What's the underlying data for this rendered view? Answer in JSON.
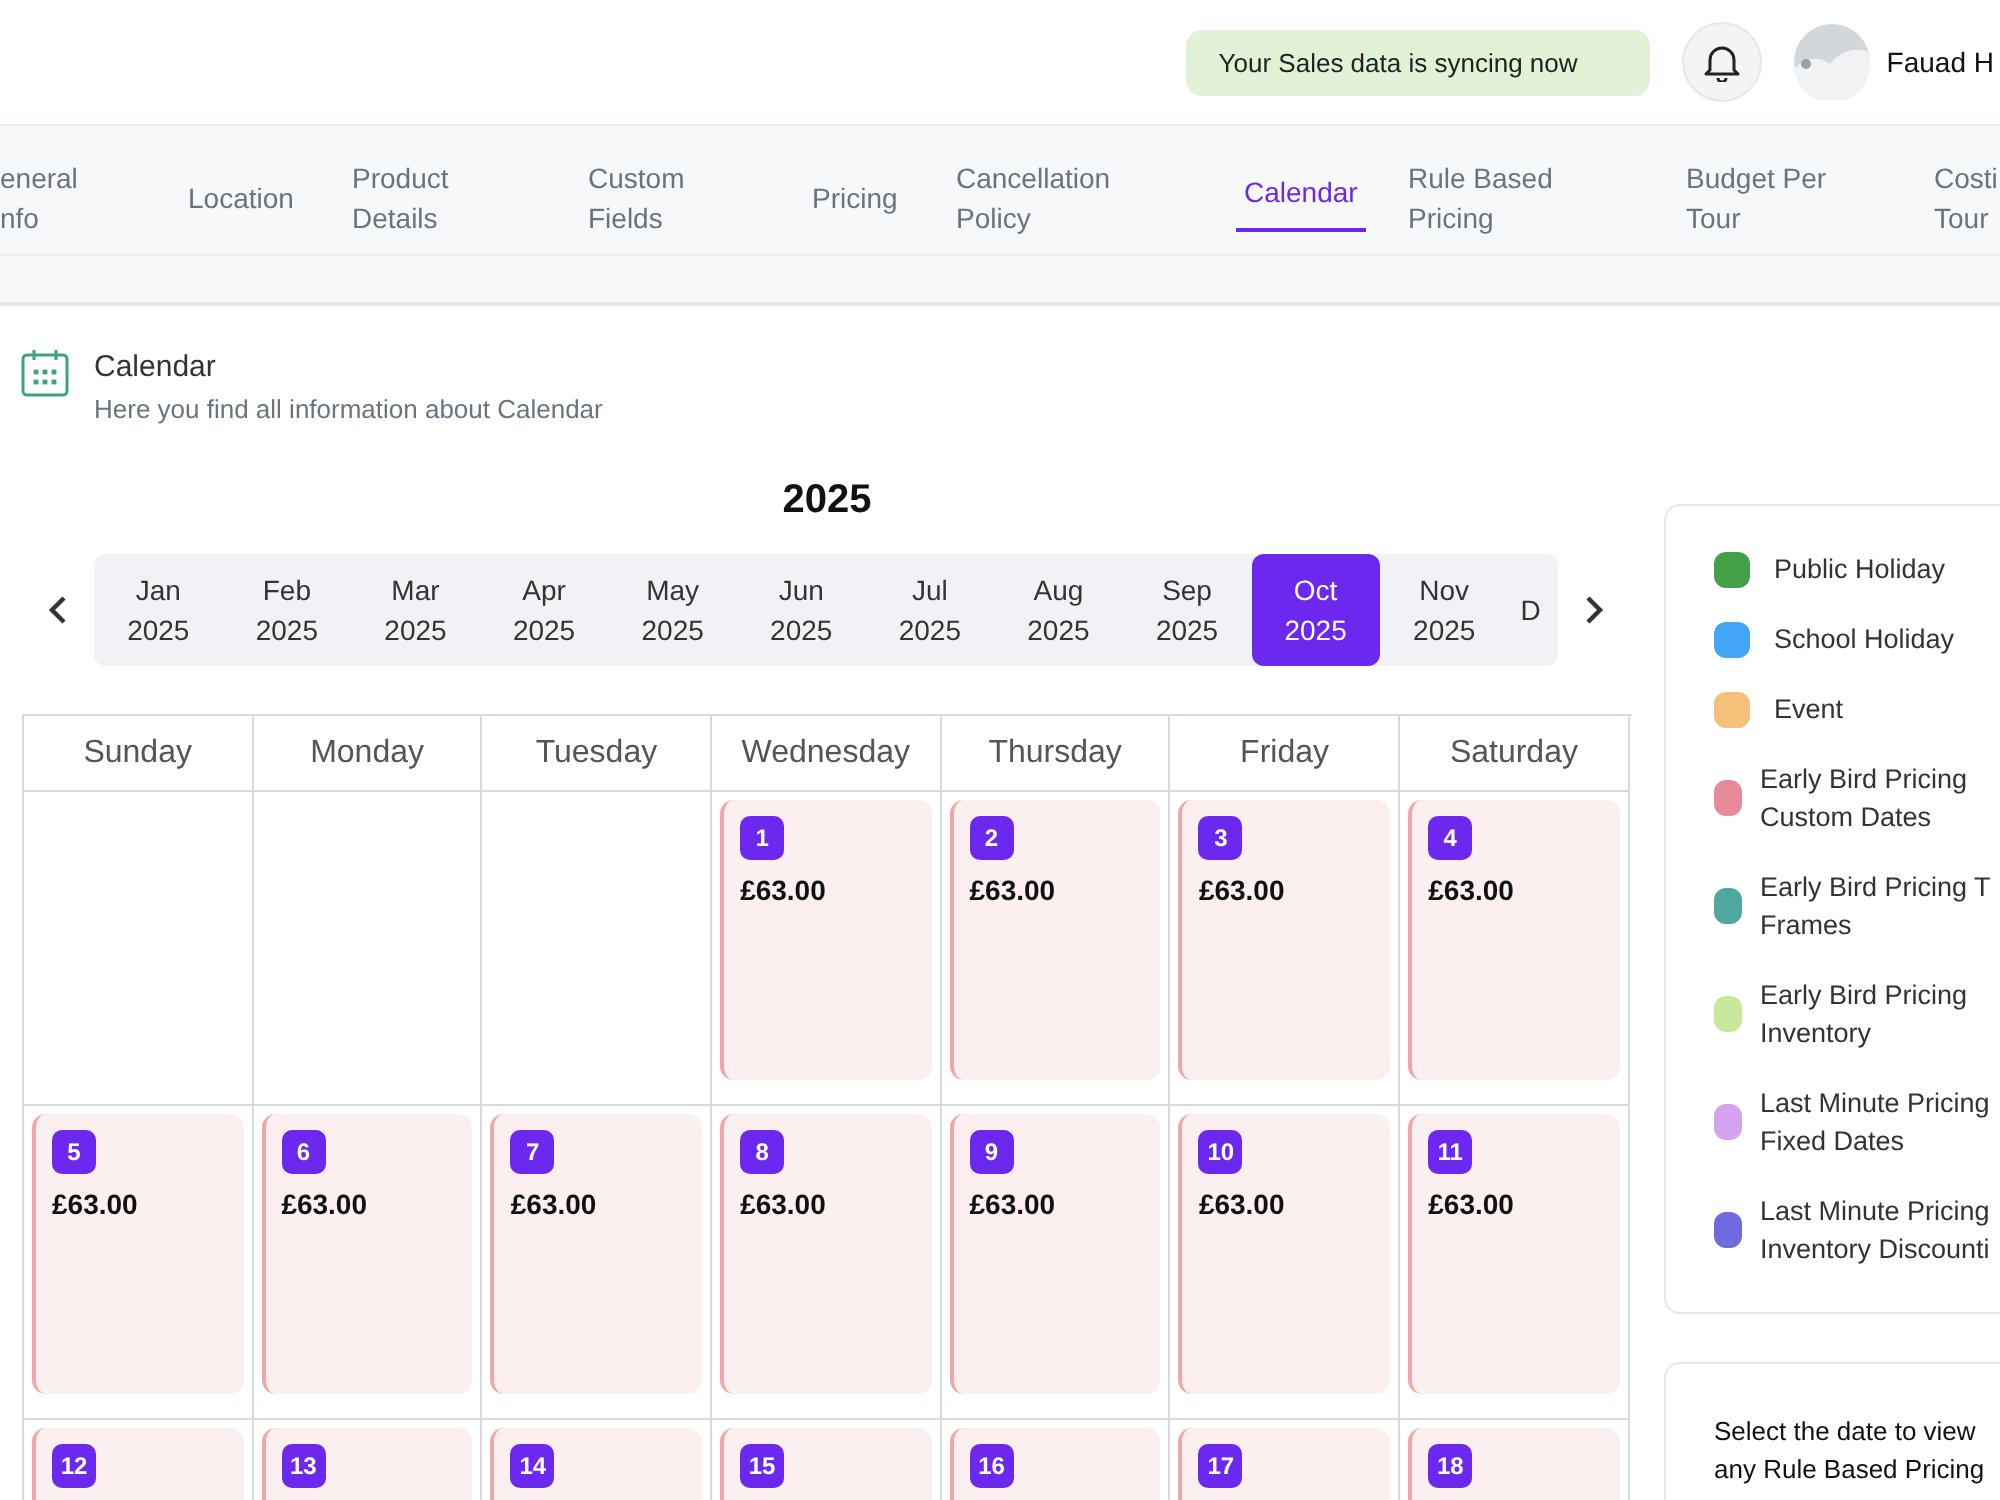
{
  "sync_notice": "Your Sales data is syncing now",
  "user": {
    "name": "Fauad H"
  },
  "tabs": [
    {
      "label": "eneral nfo",
      "selected": false
    },
    {
      "label": "Location",
      "selected": false
    },
    {
      "label": "Product Details",
      "selected": false
    },
    {
      "label": "Custom Fields",
      "selected": false
    },
    {
      "label": "Pricing",
      "selected": false
    },
    {
      "label": "Cancellation Policy",
      "selected": false
    },
    {
      "label": "Calendar",
      "selected": true
    },
    {
      "label": "Rule Based Pricing",
      "selected": false
    },
    {
      "label": "Budget Per Tour",
      "selected": false
    },
    {
      "label": "Costi Tour",
      "selected": false
    }
  ],
  "section": {
    "title": "Calendar",
    "subtitle": "Here you find all information about Calendar"
  },
  "year": "2025",
  "months": [
    {
      "month": "Jan",
      "year": "2025",
      "selected": false
    },
    {
      "month": "Feb",
      "year": "2025",
      "selected": false
    },
    {
      "month": "Mar",
      "year": "2025",
      "selected": false
    },
    {
      "month": "Apr",
      "year": "2025",
      "selected": false
    },
    {
      "month": "May",
      "year": "2025",
      "selected": false
    },
    {
      "month": "Jun",
      "year": "2025",
      "selected": false
    },
    {
      "month": "Jul",
      "year": "2025",
      "selected": false
    },
    {
      "month": "Aug",
      "year": "2025",
      "selected": false
    },
    {
      "month": "Sep",
      "year": "2025",
      "selected": false
    },
    {
      "month": "Oct",
      "year": "2025",
      "selected": true
    },
    {
      "month": "Nov",
      "year": "2025",
      "selected": false
    },
    {
      "month": "D",
      "selected": false
    }
  ],
  "weekdays": [
    "Sunday",
    "Monday",
    "Tuesday",
    "Wednesday",
    "Thursday",
    "Friday",
    "Saturday"
  ],
  "weeks": [
    [
      {
        "kind": "blank"
      },
      {
        "kind": "blank"
      },
      {
        "kind": "blank"
      },
      {
        "day": "1",
        "price": "£63.00"
      },
      {
        "day": "2",
        "price": "£63.00"
      },
      {
        "day": "3",
        "price": "£63.00"
      },
      {
        "day": "4",
        "price": "£63.00"
      }
    ],
    [
      {
        "day": "5",
        "price": "£63.00"
      },
      {
        "day": "6",
        "price": "£63.00"
      },
      {
        "day": "7",
        "price": "£63.00"
      },
      {
        "day": "8",
        "price": "£63.00"
      },
      {
        "day": "9",
        "price": "£63.00"
      },
      {
        "day": "10",
        "price": "£63.00"
      },
      {
        "day": "11",
        "price": "£63.00"
      }
    ],
    [
      {
        "day": "12"
      },
      {
        "day": "13"
      },
      {
        "day": "14"
      },
      {
        "day": "15"
      },
      {
        "day": "16"
      },
      {
        "day": "17"
      },
      {
        "day": "18"
      }
    ]
  ],
  "legend": [
    {
      "label": "Public Holiday",
      "color": "#43a047"
    },
    {
      "label": "School Holiday",
      "color": "#42a5f5"
    },
    {
      "label": "Event",
      "color": "#f5c07a"
    },
    {
      "label": "Early Bird Pricing Custom Dates",
      "color": "#e88a9a"
    },
    {
      "label": "Early Bird Pricing T Frames",
      "color": "#4fa8a0"
    },
    {
      "label": "Early Bird Pricing Inventory",
      "color": "#c5e89a"
    },
    {
      "label": "Last Minute Pricing Fixed Dates",
      "color": "#d4a3f0"
    },
    {
      "label": "Last Minute Pricing Inventory Discounti",
      "color": "#6f6ae0"
    }
  ],
  "info_text": "Select the date to view any Rule Based Pricing"
}
